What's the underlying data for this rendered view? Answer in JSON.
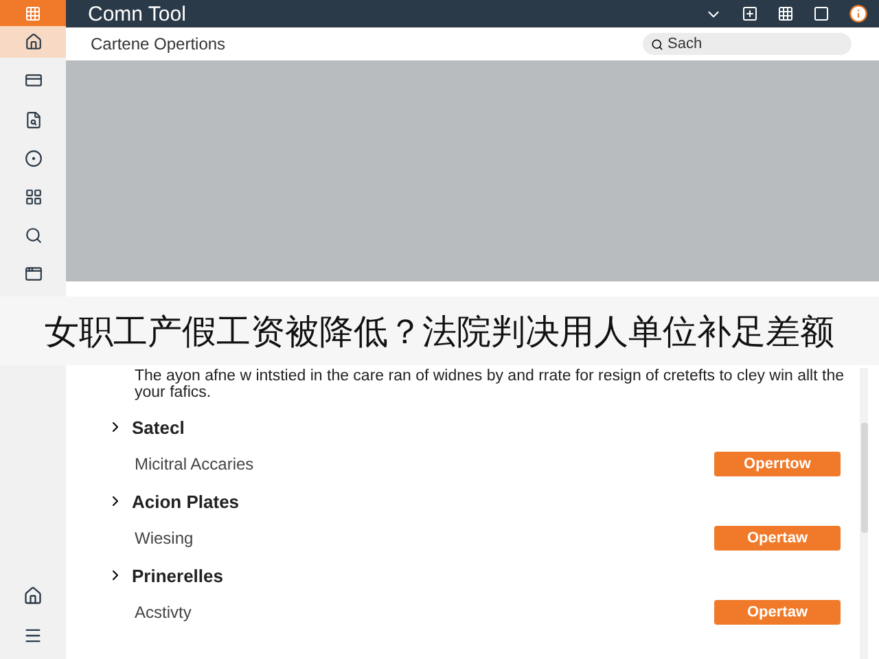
{
  "window": {
    "title": "Comn Tool"
  },
  "subheader": {
    "title": "Cartene Opertions",
    "search": {
      "placeholder": "Sach"
    }
  },
  "sidebar": {
    "items": [
      {
        "selected": true
      },
      {
        "selected": false
      },
      {
        "selected": false
      },
      {
        "selected": false
      },
      {
        "selected": false
      },
      {
        "selected": false
      },
      {
        "selected": false
      }
    ]
  },
  "caption": "女职工产假工资被降低？法院判决用人单位补足差额",
  "panel": {
    "sections": [
      {
        "kind": "paragraph",
        "text": "The ayon afne w intstied in the care ran of widnes by and rrate for resign of cretefts to cley win allt the your fafics."
      },
      {
        "kind": "item",
        "title": "Satecl",
        "label": "Micitral Accaries",
        "button": "Operrtow"
      },
      {
        "kind": "item",
        "title": "Acion Plates",
        "label": "Wiesing",
        "button": "Opertaw"
      },
      {
        "kind": "item",
        "title": "Prinerelles",
        "label": "Acstivty",
        "button": "Opertaw"
      }
    ]
  }
}
